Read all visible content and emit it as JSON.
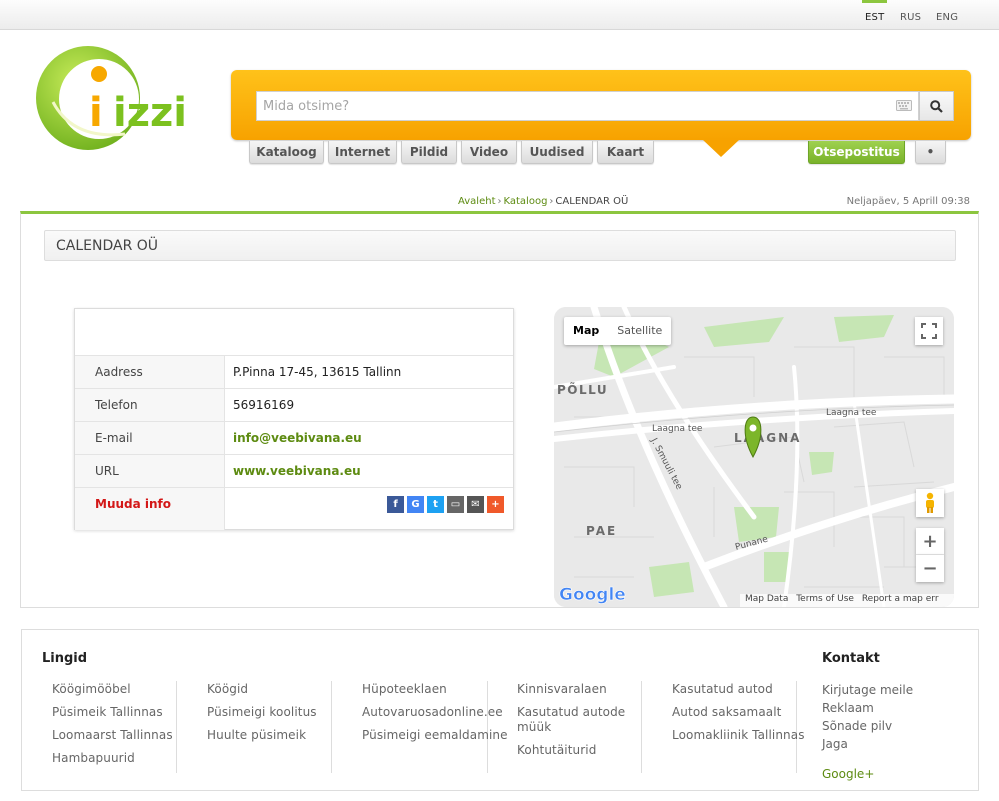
{
  "languages": [
    {
      "label": "EST",
      "active": true
    },
    {
      "label": "RUS",
      "active": false
    },
    {
      "label": "ENG",
      "active": false
    }
  ],
  "logo": {
    "text": "izzi"
  },
  "search": {
    "placeholder": "Mida otsime?"
  },
  "tabs": [
    "Kataloog",
    "Internet",
    "Pildid",
    "Video",
    "Uudised",
    "Kaart"
  ],
  "post_button": "Otsepostitus",
  "more_button": "•",
  "breadcrumb": {
    "home": "Avaleht",
    "catalog": "Kataloog",
    "current": "CALENDAR OÜ",
    "separator": "›"
  },
  "datetime": "Neljapäev, 5 Aprill 09:38",
  "company": {
    "title": "CALENDAR OÜ",
    "rows": [
      {
        "label": "Aadress",
        "value": "P.Pinna 17-45, 13615 Tallinn"
      },
      {
        "label": "Telefon",
        "value": "56916169"
      },
      {
        "label": "E-mail",
        "value": "info@veebivana.eu"
      },
      {
        "label": "URL",
        "value": "www.veebivana.eu"
      }
    ],
    "edit_label": "Muuda info"
  },
  "share_icons": [
    {
      "name": "facebook-icon",
      "glyph": "f",
      "color": "#3b5998"
    },
    {
      "name": "google-icon",
      "glyph": "G",
      "color": "#4285f4"
    },
    {
      "name": "twitter-icon",
      "glyph": "t",
      "color": "#1da1f2"
    },
    {
      "name": "print-icon",
      "glyph": "▭",
      "color": "#666666"
    },
    {
      "name": "email-icon",
      "glyph": "✉",
      "color": "#555555"
    },
    {
      "name": "add-icon",
      "glyph": "+",
      "color": "#f0592a"
    }
  ],
  "map": {
    "type_buttons": [
      "Map",
      "Satellite"
    ],
    "labels": {
      "pollu": "PÕLLU",
      "laagna": "LAAGNA",
      "pae": "PAE",
      "laagna_tee_1": "Laagna tee",
      "laagna_tee_2": "Laagna tee",
      "smuuli": "J. Smuuli tee",
      "punane": "Punane"
    },
    "zoom_in": "+",
    "zoom_out": "−",
    "brand": "Google",
    "footer": [
      "Map Data",
      "Terms of Use",
      "Report a map err"
    ]
  },
  "footer": {
    "links_heading": "Lingid",
    "contact_heading": "Kontakt",
    "columns": [
      [
        "Köögimööbel",
        "Püsimeik Tallinnas",
        "Loomaarst Tallinnas",
        "Hambapuurid"
      ],
      [
        "Köögid",
        "Püsimeigi koolitus",
        "Huulte püsimeik"
      ],
      [
        "Hüpoteeklaen",
        "Autovaruosadonline.ee",
        "Püsimeigi eemaldamine"
      ],
      [
        "Kinnisvaralaen",
        "Kasutatud autode",
        "müük",
        "Kohtutäiturid"
      ],
      [
        "Kasutatud autod",
        "Autod saksamaalt",
        "Loomakliinik Tallinnas"
      ]
    ],
    "contact": [
      "Kirjutage meile",
      "Reklaam",
      "Sõnade pilv",
      "Jaga"
    ],
    "gplus": "Google+"
  }
}
